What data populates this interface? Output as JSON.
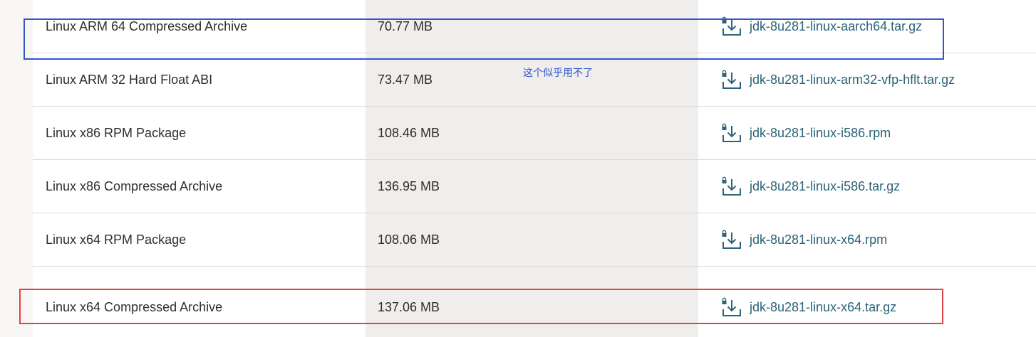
{
  "rows": [
    {
      "product": "Linux ARM 64 Compressed Archive",
      "size": "70.77 MB",
      "file": "jdk-8u281-linux-aarch64.tar.gz"
    },
    {
      "product": "Linux ARM 32 Hard Float ABI",
      "size": "73.47 MB",
      "file": "jdk-8u281-linux-arm32-vfp-hflt.tar.gz"
    },
    {
      "product": "Linux x86 RPM Package",
      "size": "108.46 MB",
      "file": "jdk-8u281-linux-i586.rpm"
    },
    {
      "product": "Linux x86 Compressed Archive",
      "size": "136.95 MB",
      "file": "jdk-8u281-linux-i586.tar.gz"
    },
    {
      "product": "Linux x64 RPM Package",
      "size": "108.06 MB",
      "file": "jdk-8u281-linux-x64.rpm"
    },
    {
      "product": "Linux x64 Compressed Archive",
      "size": "137.06 MB",
      "file": "jdk-8u281-linux-x64.tar.gz"
    }
  ],
  "icons": {
    "download": "lock-download-icon"
  },
  "colors": {
    "link": "#2b6378",
    "text": "#312d2a",
    "size_column_bg": "#efeeec",
    "annotation_blue": "#3355cc",
    "annotation_red": "#e04444"
  },
  "annotations": {
    "blue_note": "这个似乎用不了"
  }
}
